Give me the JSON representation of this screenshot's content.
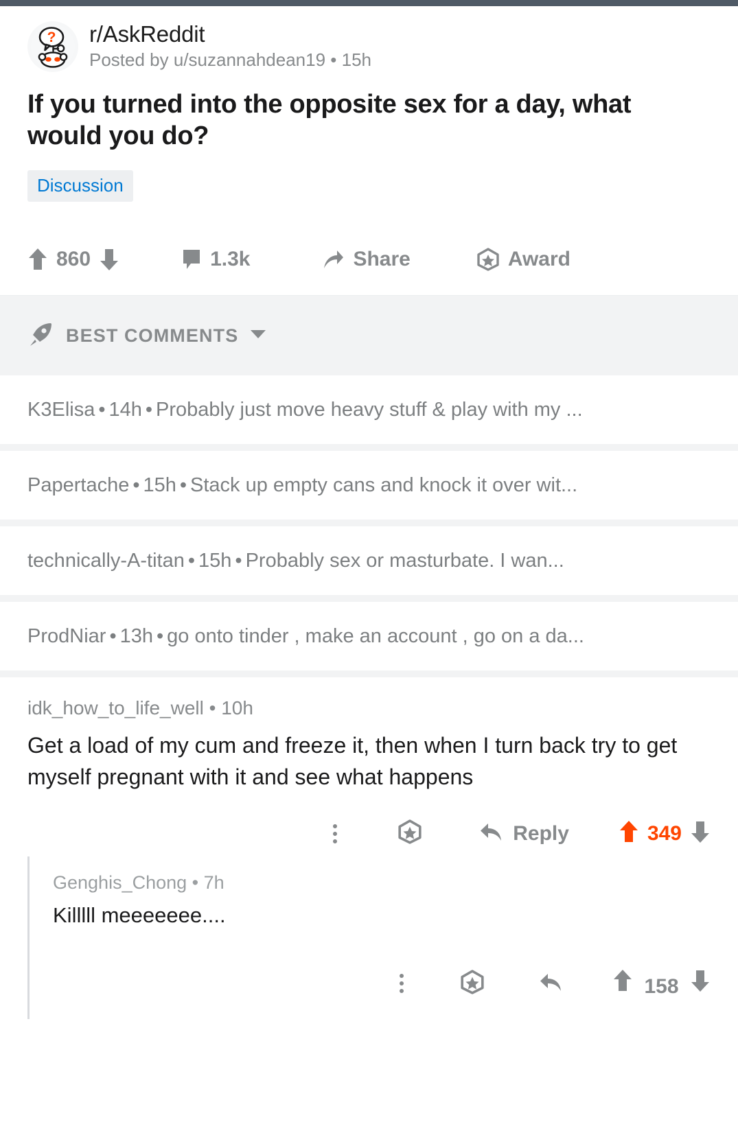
{
  "post": {
    "subreddit": "r/AskReddit",
    "posted_by": "Posted by u/suzannahdean19 • 15h",
    "title": "If you turned into the opposite sex for a day, what would you do?",
    "flair": "Discussion",
    "avatar_icon": "askreddit-snoo-question-avatar",
    "actions": {
      "upvote_icon": "upvote-arrow-icon",
      "score": "860",
      "downvote_icon": "downvote-arrow-icon",
      "comment_icon": "comment-bubble-icon",
      "comment_count": "1.3k",
      "share_icon": "share-arrow-icon",
      "share_label": "Share",
      "award_icon": "award-star-icon",
      "award_label": "Award"
    }
  },
  "sort": {
    "icon": "rocket-icon",
    "label": "BEST COMMENTS",
    "chevron_icon": "chevron-down-icon"
  },
  "collapsed_comments": [
    {
      "author": "K3Elisa",
      "age": "14h",
      "preview": "Probably just move heavy stuff & play with my ..."
    },
    {
      "author": "Papertache",
      "age": "15h",
      "preview": "Stack up empty cans and knock it over wit..."
    },
    {
      "author": "technically-A-titan",
      "age": "15h",
      "preview": "Probably sex or masturbate. I wan..."
    },
    {
      "author": "ProdNiar",
      "age": "13h",
      "preview": "go onto tinder , make an account , go on a da..."
    }
  ],
  "expanded_comment": {
    "author": "idk_how_to_life_well",
    "separator": "•",
    "age": "10h",
    "body": "Get a load of my cum and freeze it, then when I turn back try to get myself pregnant with it and see what happens",
    "actions": {
      "more_icon": "kebab-more-icon",
      "award_icon": "award-star-icon",
      "reply_icon": "reply-arrow-icon",
      "reply_label": "Reply",
      "upvote_icon": "upvote-arrow-icon",
      "score": "349",
      "downvote_icon": "downvote-arrow-icon"
    }
  },
  "nested_reply": {
    "author": "Genghis_Chong",
    "separator": "•",
    "age": "7h",
    "body": "Killlll meeeeeee....",
    "actions": {
      "more_icon": "kebab-more-icon",
      "award_icon": "award-star-icon",
      "reply_icon": "reply-arrow-icon",
      "upvote_icon": "upvote-arrow-icon",
      "score": "158",
      "downvote_icon": "downvote-arrow-icon"
    }
  },
  "colors": {
    "upvote_orange": "#ff4500",
    "link_blue": "#0079d3",
    "meta_gray": "#878a8c",
    "chrome_bar": "#4f5a66",
    "surface_gray": "#f2f3f4"
  }
}
